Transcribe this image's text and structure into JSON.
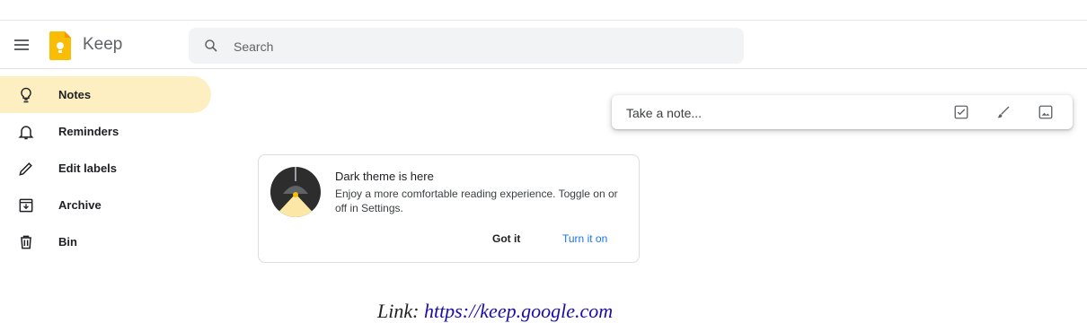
{
  "app": {
    "name": "Keep"
  },
  "search": {
    "placeholder": "Search"
  },
  "sidebar": {
    "items": [
      {
        "label": "Notes",
        "icon": "lightbulb-icon",
        "active": true
      },
      {
        "label": "Reminders",
        "icon": "bell-icon"
      },
      {
        "label": "Edit labels",
        "icon": "pencil-icon"
      },
      {
        "label": "Archive",
        "icon": "archive-icon"
      },
      {
        "label": "Bin",
        "icon": "trash-icon"
      }
    ]
  },
  "take_note": {
    "placeholder": "Take a note...",
    "icons": [
      "checkbox-icon",
      "brush-icon",
      "image-icon"
    ]
  },
  "card": {
    "title": "Dark theme is here",
    "body": "Enjoy a more comfortable reading experience. Toggle on or off in Settings.",
    "got_it": "Got it",
    "turn_on": "Turn it on"
  },
  "caption": {
    "prefix": "Link: ",
    "link": "https://keep.google.com"
  },
  "colors": {
    "active_bg": "#feefc3",
    "accent": "#1a73e8",
    "logo": "#fbbc04"
  }
}
